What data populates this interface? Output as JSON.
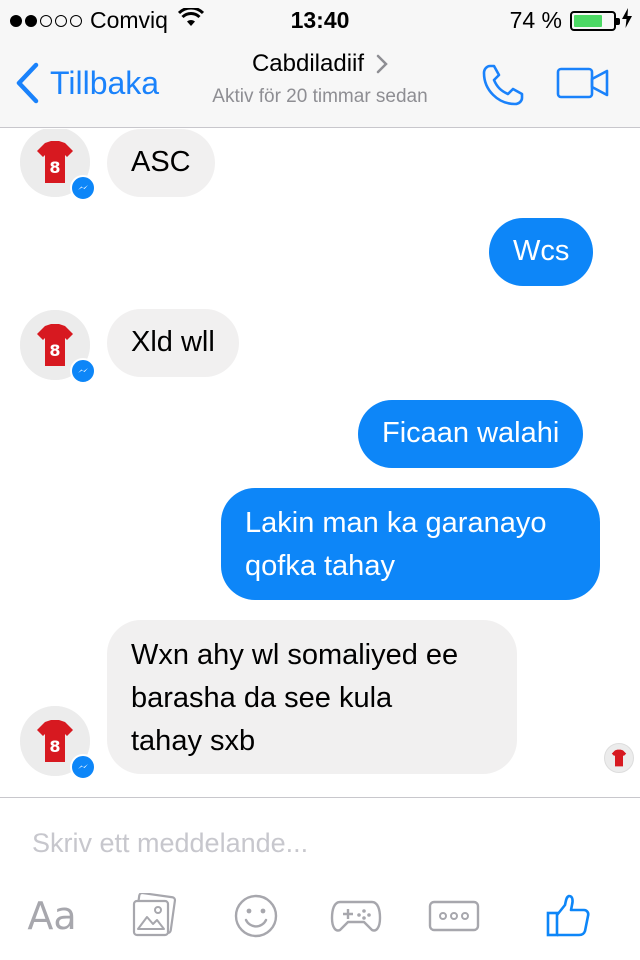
{
  "status_bar": {
    "carrier": "Comviq",
    "time": "13:40",
    "battery_percent": "74 %",
    "battery_level": 0.74,
    "signal_bars": 2,
    "icons": [
      "signal-dots",
      "wifi-icon",
      "battery-icon",
      "charging-bolt-icon"
    ]
  },
  "nav": {
    "back_label": "Tillbaka",
    "contact_name": "Cabdiladiif",
    "active_status": "Aktiv för 20 timmar sedan",
    "icons": [
      "chevron-left-icon",
      "chevron-right-icon",
      "phone-icon",
      "video-camera-icon"
    ]
  },
  "messages": [
    {
      "direction": "incoming",
      "text": "ASC"
    },
    {
      "direction": "outgoing",
      "text": "Wcs"
    },
    {
      "direction": "incoming",
      "text": "Xld wll"
    },
    {
      "direction": "outgoing",
      "text": "Ficaan walahi"
    },
    {
      "direction": "outgoing",
      "text_lines": [
        "Lakin man ka garanayo",
        "qofka tahay"
      ]
    },
    {
      "direction": "incoming",
      "text_lines": [
        "Wxn ahy wl somaliyed ee",
        "barasha da see kula",
        "tahay sxb"
      ]
    }
  ],
  "avatar": {
    "jersey_number": "8",
    "jersey_color": "#d71920"
  },
  "composer": {
    "placeholder": "Skriv ett meddelande...",
    "aa_label": "Aa",
    "tools": [
      "text-format-icon",
      "photo-icon",
      "emoji-icon",
      "game-icon",
      "more-icon",
      "like-icon"
    ]
  },
  "colors": {
    "accent": "#0d86f8",
    "incoming_bubble": "#f1f0f0",
    "bar_bg": "#f7f7f7"
  }
}
